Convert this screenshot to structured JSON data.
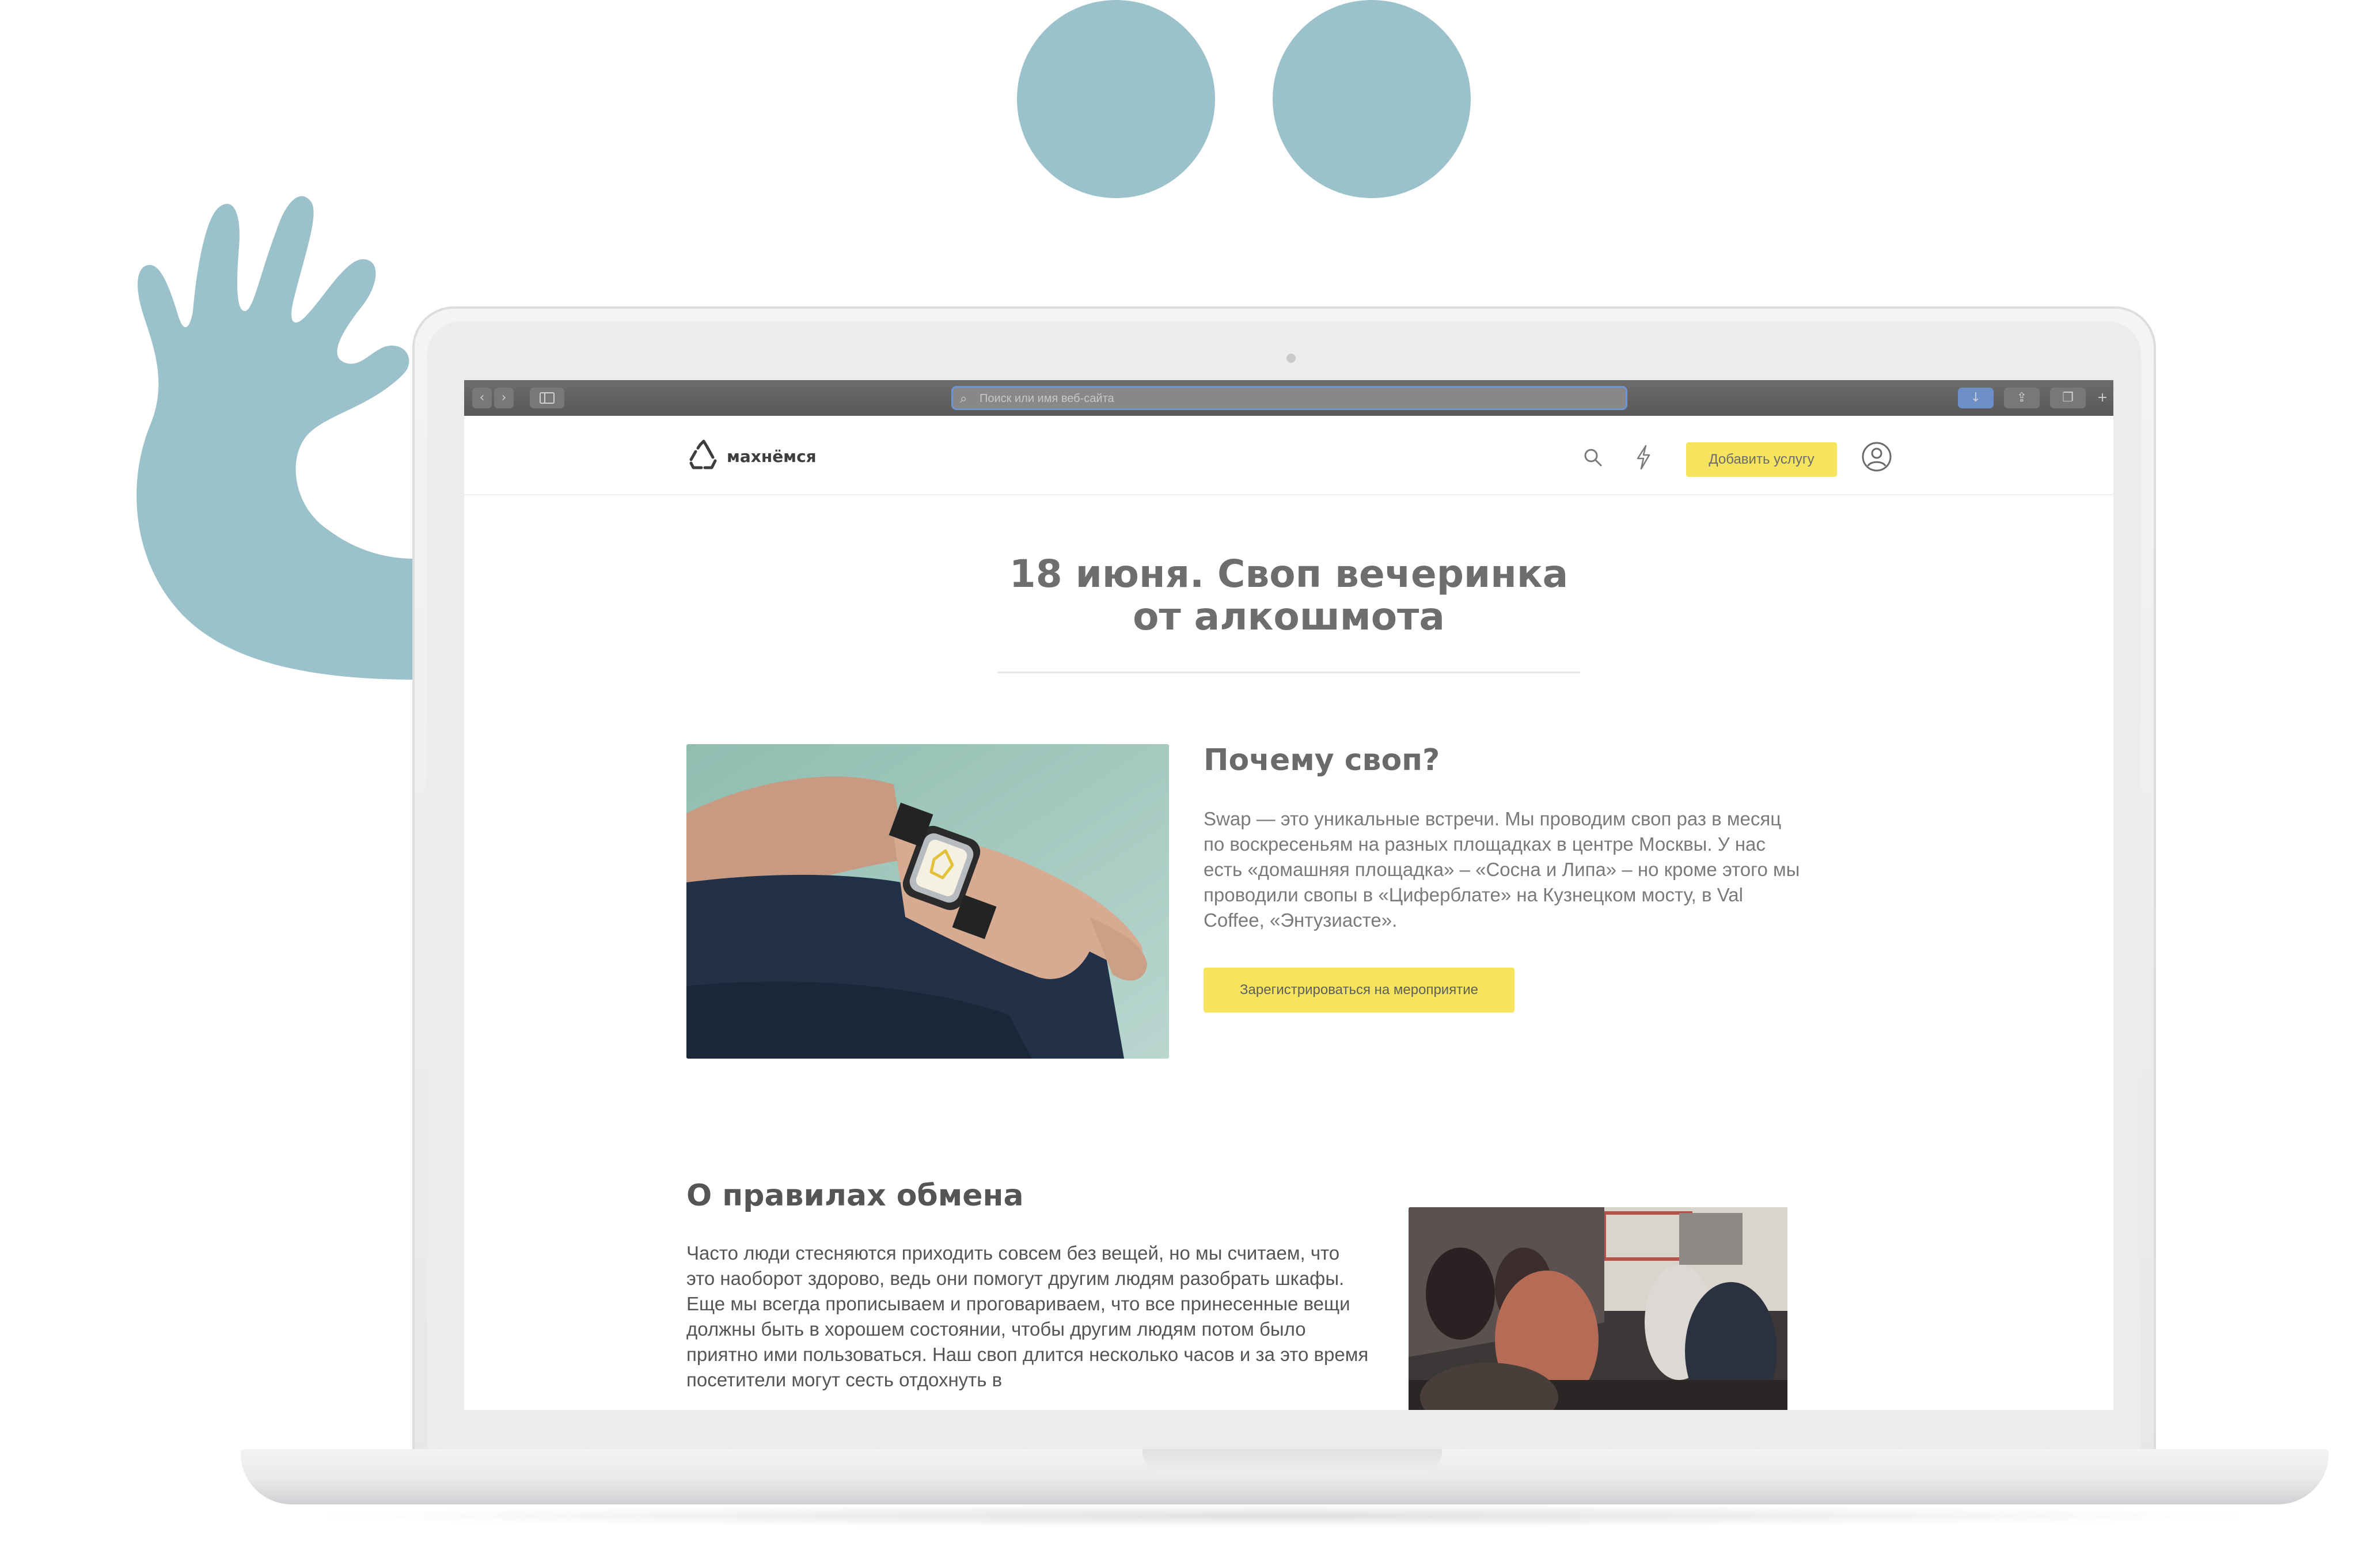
{
  "browser": {
    "address_placeholder": "Поиск или имя веб-сайта"
  },
  "site": {
    "logo_text": "махнёмся",
    "add_service_label": "Добавить услугу"
  },
  "article": {
    "title_line1": "18 июня. Своп вечеринка",
    "title_line2": "от алкошмота",
    "why_heading": "Почему своп?",
    "why_text": "Swap — это уникальные встречи. Мы проводим своп раз в месяц по воскресеньям на разных площадках в центре Москвы. У нас есть «домашняя площадка» – «Сосна и Липа» – но кроме этого мы проводили свопы в «Циферблате» на Кузнецком мосту, в Val Coffee, «Энтузиасте».",
    "register_label": "Зарегистрироваться на мероприятие",
    "rules_heading": "О правилах обмена",
    "rules_text": "Часто люди стесняются приходить совсем без вещей, но мы считаем, что это наоборот здорово, ведь они помогут другим людям разобрать шкафы. Еще мы всегда прописываем и проговариваем, что все принесенные вещи должны быть в хорошем состоянии, чтобы другим людям потом было приятно ими пользоваться. Наш своп длится несколько часов и за это время посетители могут сесть отдохнуть в"
  },
  "colors": {
    "accent_yellow": "#f6e45f",
    "decor_blue": "#9bc1cb"
  }
}
